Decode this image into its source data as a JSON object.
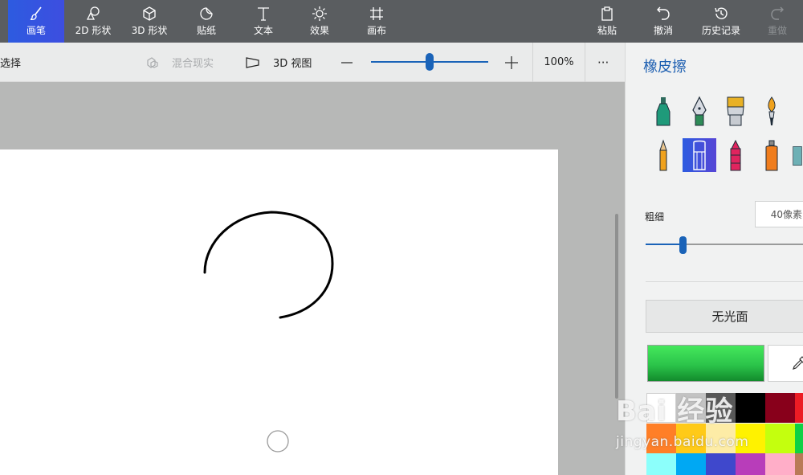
{
  "toolbar": {
    "brushes": "画笔",
    "shapes2d": "2D 形状",
    "shapes3d": "3D 形状",
    "stickers": "贴纸",
    "text": "文本",
    "effects": "效果",
    "canvas": "画布",
    "paste": "粘贴",
    "undo": "撤消",
    "history": "历史记录",
    "redo": "重做"
  },
  "subbar": {
    "select": "选择",
    "mixed_reality": "混合现实",
    "view3d": "3D 视图",
    "zoom": "100%",
    "more": "···",
    "zoom_level": 0.5
  },
  "panel": {
    "title": "橡皮擦",
    "thickness_label": "粗细",
    "thickness_value": "40像素",
    "thickness_level": 0.24,
    "finish": "无光面",
    "selected_color": "#2bc44a",
    "tools": [
      "marker-icon",
      "calligraphy-pen-icon",
      "oil-brush-icon",
      "watercolor-icon",
      "pencil-icon",
      "eraser-icon",
      "crayon-icon",
      "spray-can-icon",
      "pixel-pen-icon"
    ],
    "palette": [
      [
        "#ffffff",
        "#c3c3c3",
        "#585858",
        "#000000",
        "#88001b",
        "#ec1c24"
      ],
      [
        "#ff7f27",
        "#ffca18",
        "#fdeca6",
        "#fff200",
        "#c4ff0e",
        "#0ed145"
      ],
      [
        "#8cfffb",
        "#00a8f3",
        "#3f48cc",
        "#b83dba",
        "#ffaec8",
        "#b97a56"
      ]
    ]
  },
  "watermark": {
    "main": "Bai 经验",
    "sub": "jingyan.baidu.com"
  }
}
